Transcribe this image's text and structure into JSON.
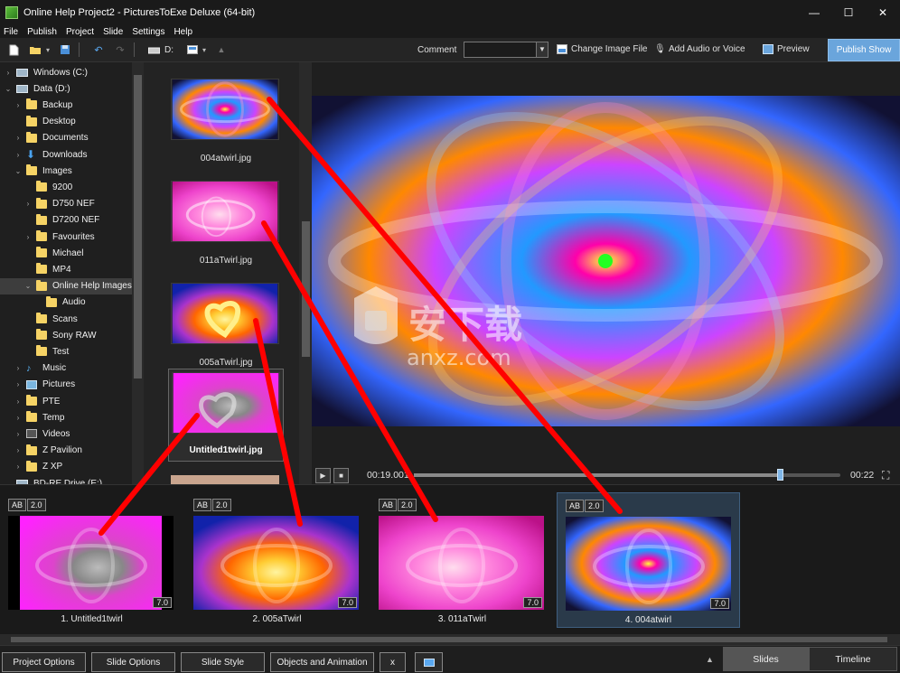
{
  "window": {
    "title": "Online Help Project2 - PicturesToExe Deluxe (64-bit)",
    "minimize": "—",
    "maximize": "☐",
    "close": "✕"
  },
  "menu": [
    "File",
    "Publish",
    "Project",
    "Slide",
    "Settings",
    "Help"
  ],
  "toolbar": {
    "drive_label": "D:",
    "comment_label": "Comment",
    "comment_value": "",
    "change_image": "Change Image File",
    "add_audio": "Add Audio or Voice",
    "preview": "Preview",
    "publish": "Publish Show"
  },
  "tree": [
    {
      "label": "Windows (C:)",
      "icon": "drive",
      "expander": "›",
      "level": 0
    },
    {
      "label": "Data (D:)",
      "icon": "drive",
      "expander": "⌄",
      "level": 0
    },
    {
      "label": "Backup",
      "icon": "folder",
      "expander": "›",
      "level": 1
    },
    {
      "label": "Desktop",
      "icon": "folder",
      "expander": "",
      "level": 1
    },
    {
      "label": "Documents",
      "icon": "folder",
      "expander": "›",
      "level": 1
    },
    {
      "label": "Downloads",
      "icon": "download",
      "expander": "›",
      "level": 1
    },
    {
      "label": "Images",
      "icon": "folder",
      "expander": "⌄",
      "level": 1
    },
    {
      "label": "9200",
      "icon": "folder",
      "expander": "",
      "level": 2
    },
    {
      "label": "D750 NEF",
      "icon": "folder",
      "expander": "›",
      "level": 2
    },
    {
      "label": "D7200 NEF",
      "icon": "folder",
      "expander": "",
      "level": 2
    },
    {
      "label": "Favourites",
      "icon": "folder",
      "expander": "›",
      "level": 2
    },
    {
      "label": "Michael",
      "icon": "folder",
      "expander": "",
      "level": 2
    },
    {
      "label": "MP4",
      "icon": "folder",
      "expander": "",
      "level": 2
    },
    {
      "label": "Online Help Images",
      "icon": "folder",
      "expander": "⌄",
      "level": 2,
      "selected": true
    },
    {
      "label": "Audio",
      "icon": "folder",
      "expander": "",
      "level": 3
    },
    {
      "label": "Scans",
      "icon": "folder",
      "expander": "",
      "level": 2
    },
    {
      "label": "Sony RAW",
      "icon": "folder",
      "expander": "",
      "level": 2
    },
    {
      "label": "Test",
      "icon": "folder",
      "expander": "",
      "level": 2
    },
    {
      "label": "Music",
      "icon": "music",
      "expander": "›",
      "level": 1
    },
    {
      "label": "Pictures",
      "icon": "pictures",
      "expander": "›",
      "level": 1
    },
    {
      "label": "PTE",
      "icon": "folder",
      "expander": "›",
      "level": 1
    },
    {
      "label": "Temp",
      "icon": "folder",
      "expander": "›",
      "level": 1
    },
    {
      "label": "Videos",
      "icon": "video",
      "expander": "›",
      "level": 1
    },
    {
      "label": "Z Pavilion",
      "icon": "folder",
      "expander": "›",
      "level": 1
    },
    {
      "label": "Z XP",
      "icon": "folder",
      "expander": "›",
      "level": 1
    },
    {
      "label": "BD-RE Drive (E:)",
      "icon": "drive",
      "expander": "",
      "level": 0
    }
  ],
  "thumbnails": [
    {
      "name": "004atwirl.jpg",
      "style": "twirl-blue"
    },
    {
      "name": "011aTwirl.jpg",
      "style": "twirl-pink"
    },
    {
      "name": "005aTwirl.jpg",
      "style": "twirl-gold"
    },
    {
      "name": "Untitled1twirl.jpg",
      "style": "twirl-magenta",
      "selected": true
    }
  ],
  "player": {
    "current_time": "00:19.001",
    "end_time": "00:22",
    "progress": 0.86
  },
  "slides": [
    {
      "name": "1. Untitled1twirl",
      "badge_ab": "AB",
      "badge_speed": "2.0",
      "duration": "7.0",
      "style": "twirl-magenta"
    },
    {
      "name": "2. 005aTwirl",
      "badge_ab": "AB",
      "badge_speed": "2.0",
      "duration": "7.0",
      "style": "twirl-gold"
    },
    {
      "name": "3. 011aTwirl",
      "badge_ab": "AB",
      "badge_speed": "2.0",
      "duration": "7.0",
      "style": "twirl-pink"
    },
    {
      "name": "4. 004atwirl",
      "badge_ab": "AB",
      "badge_speed": "2.0",
      "duration": "7.0",
      "style": "twirl-blue",
      "active": true
    }
  ],
  "bottom": {
    "project_options": "Project Options",
    "slide_options": "Slide Options",
    "slide_style": "Slide Style",
    "objects_animation": "Objects and Animation",
    "x_button": "x",
    "slides_tab": "Slides",
    "timeline_tab": "Timeline"
  },
  "watermark": {
    "cn": "安下载",
    "en": "anxz.com"
  },
  "colors": {
    "accent": "#6aa5dc",
    "arrow": "#ff0000",
    "folder": "#f6d365"
  }
}
